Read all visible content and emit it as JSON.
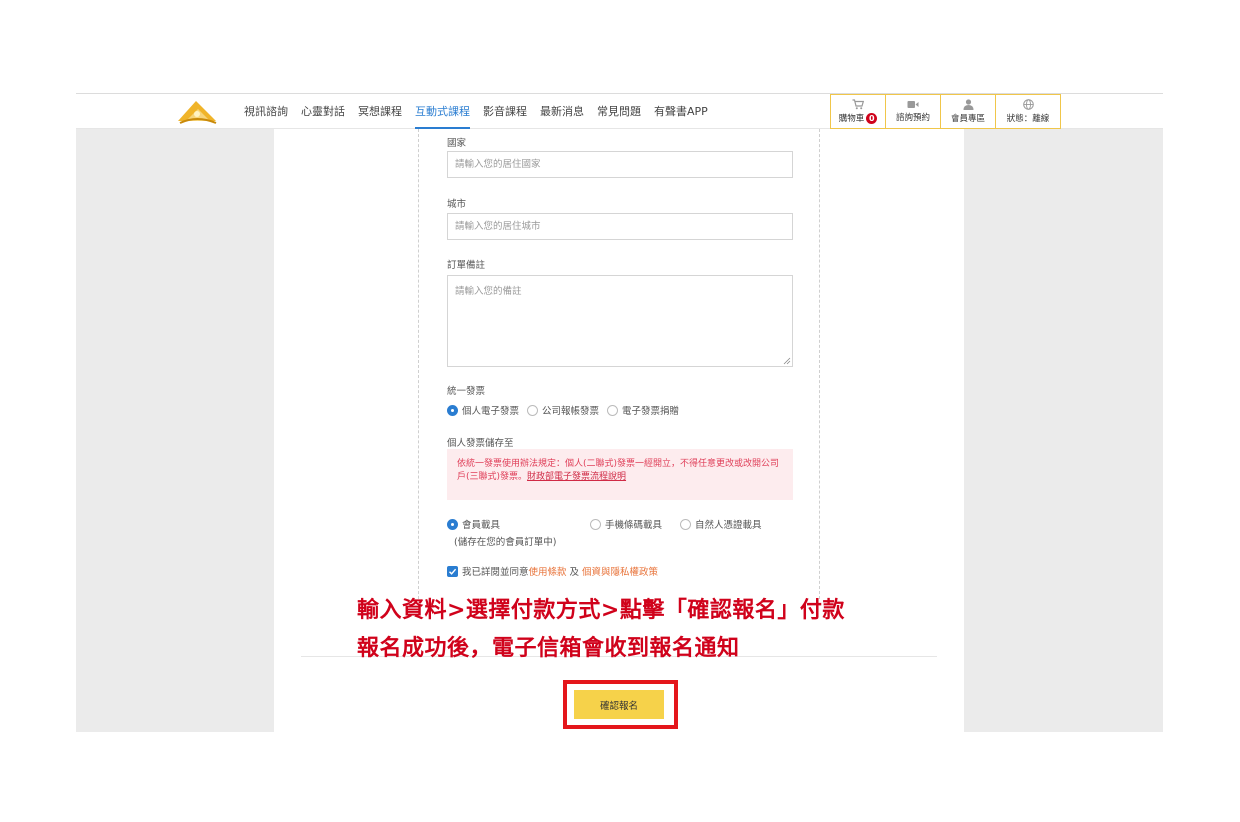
{
  "nav": {
    "links": [
      "視訊諮詢",
      "心靈對話",
      "冥想課程",
      "互動式課程",
      "影音課程",
      "最新消息",
      "常見問題",
      "有聲書APP"
    ],
    "active_index": 3,
    "cart_label": "購物車",
    "cart_count": "0",
    "consult_label": "諮詢預約",
    "member_label": "會員專區",
    "status_label": "狀態：離線"
  },
  "form": {
    "country_label": "國家",
    "country_placeholder": "請輸入您的居住國家",
    "city_label": "城市",
    "city_placeholder": "請輸入您的居住城市",
    "note_label": "訂單備註",
    "note_placeholder": "請輸入您的備註",
    "invoice_label": "統一發票",
    "invoice_options": [
      "個人電子發票",
      "公司報帳發票",
      "電子發票捐贈"
    ],
    "invoice_selected": 0,
    "store_label": "個人發票儲存至",
    "notice_text": "依統一發票使用辦法規定：個人(二聯式)發票一經開立，不得任意更改或改開公司戶(三聯式)發票。",
    "notice_link": "財政部電子發票流程說明",
    "carrier_options": [
      "會員載具",
      "手機條碼載具",
      "自然人憑證載具"
    ],
    "carrier_selected": 0,
    "carrier_note": "(儲存在您的會員訂單中)",
    "agree_prefix": "我已詳閱並同意",
    "terms_link": "使用條款",
    "agree_and": "及",
    "privacy_link": "個資與隱私權政策"
  },
  "confirm_button_label": "確認報名",
  "annotation": {
    "line1": "輸入資料>選擇付款方式>點擊「確認報名」付款",
    "line2": "報名成功後，電子信箱會收到報名通知"
  },
  "colors": {
    "accent_blue": "#2a7dd1",
    "button_yellow": "#f6d24a",
    "annotation_red": "#d0021b",
    "highlight_red": "#e4161b"
  }
}
